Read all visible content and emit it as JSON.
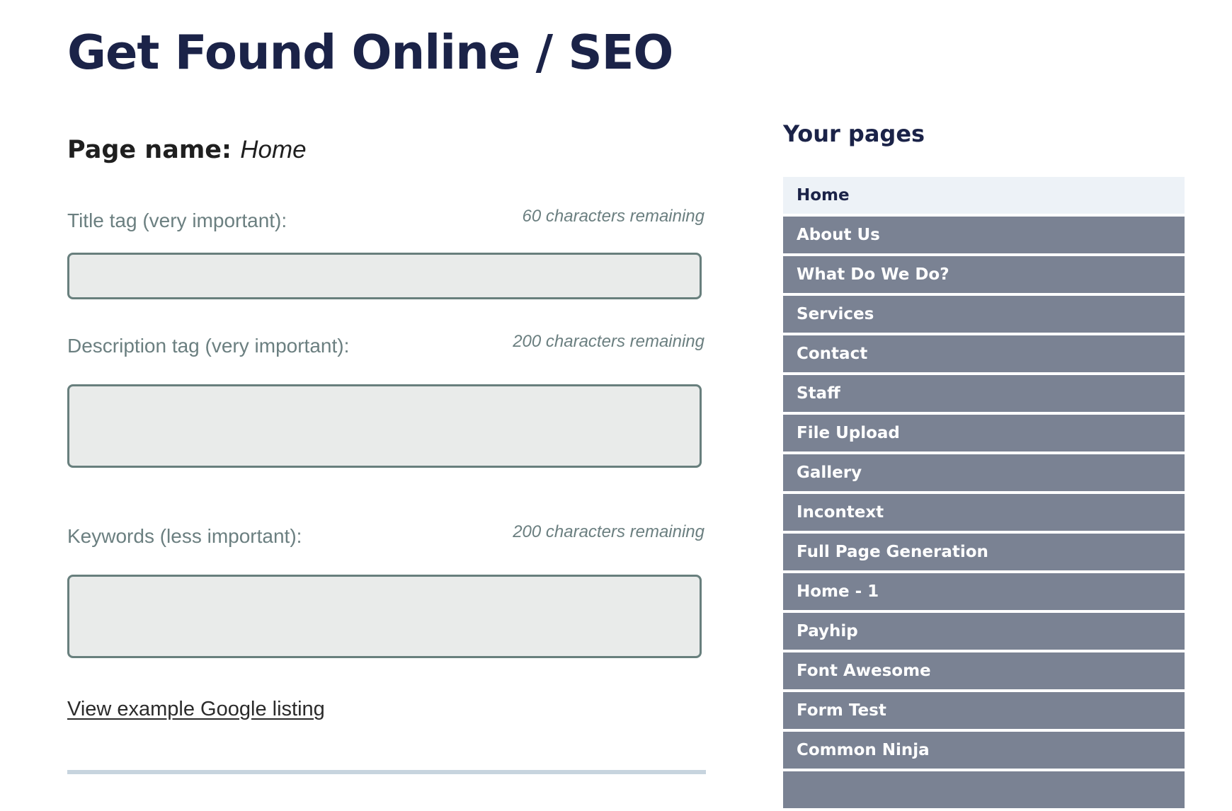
{
  "header": {
    "title": "Get Found Online / SEO"
  },
  "page_name": {
    "label": "Page name:",
    "value": "Home"
  },
  "fields": {
    "title_tag": {
      "label": "Title tag (very important):",
      "remaining": "60 characters remaining",
      "value": ""
    },
    "description_tag": {
      "label": "Description tag (very important):",
      "remaining": "200 characters remaining",
      "value": ""
    },
    "keywords": {
      "label": "Keywords (less important):",
      "remaining": "200 characters remaining",
      "value": ""
    }
  },
  "google_link": "View example Google listing",
  "sidebar": {
    "title": "Your pages",
    "active_index": 0,
    "pages": [
      "Home",
      "About Us",
      "What Do We Do?",
      "Services",
      "Contact",
      "Staff",
      "File Upload",
      "Gallery",
      "Incontext",
      "Full Page Generation",
      "Home - 1",
      "Payhip",
      "Font Awesome",
      "Form Test",
      "Common Ninja"
    ]
  },
  "colors": {
    "heading": "#1b2348",
    "label": "#6b7f80",
    "field_bg": "#e9ebea",
    "field_border": "#687f7d",
    "page_item_bg": "#7a8293",
    "page_item_active_bg": "#edf2f7",
    "divider": "#c7d4de"
  }
}
